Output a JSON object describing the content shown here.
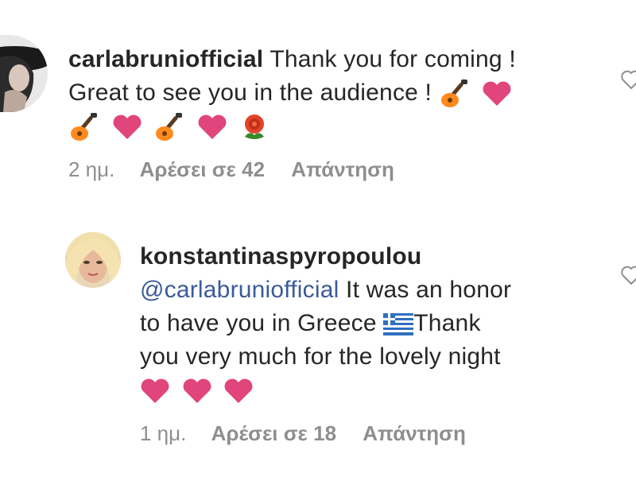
{
  "comments": [
    {
      "username": "carlabruniofficial",
      "lines": [
        "Thank you for coming !",
        "Great to see you in the audience !"
      ],
      "time": "2 ημ.",
      "likes": "Αρέσει σε 42",
      "reply": "Απάντηση",
      "emojis": [
        "guitar",
        "pink-heart",
        "guitar",
        "pink-heart",
        "guitar",
        "pink-heart",
        "rose"
      ]
    },
    {
      "username": "konstantinaspyropoulou",
      "mention": "@carlabruniofficial",
      "lines": [
        "It was an honor",
        "to have you in Greece",
        "Thank",
        "you very much for the lovely night"
      ],
      "time": "1 ημ.",
      "likes": "Αρέσει σε 18",
      "reply": "Απάντηση",
      "emojis": [
        "greek-flag",
        "pink-heart",
        "pink-heart",
        "pink-heart"
      ]
    }
  ],
  "colors": {
    "text": "#262626",
    "meta": "#8e8e8e",
    "mention": "#3a5a9a",
    "heart": "#e0457b"
  }
}
